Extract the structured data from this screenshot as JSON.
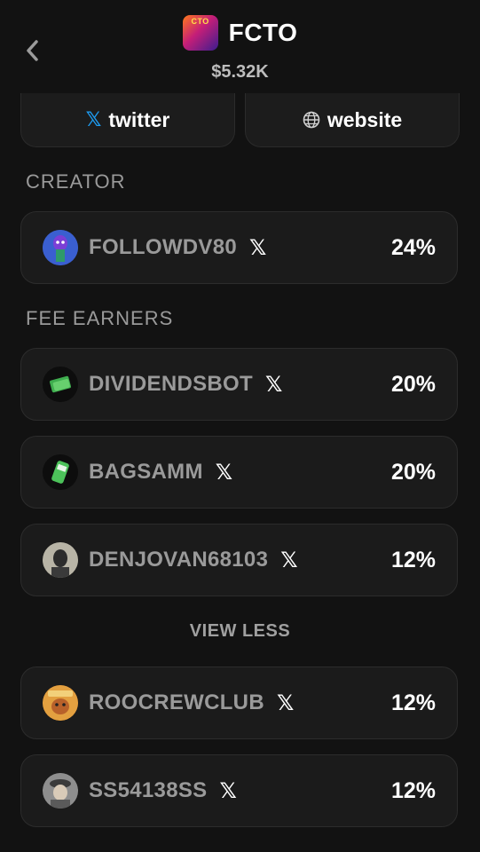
{
  "header": {
    "back_icon": "chevron-left-icon",
    "token_logo_text": "CTO",
    "token_name": "FCTO",
    "market_cap": "$5.32K"
  },
  "links": {
    "twitter": {
      "icon": "x-logo-icon",
      "label": "twitter"
    },
    "website": {
      "icon": "globe-icon",
      "label": "website"
    }
  },
  "creator": {
    "title": "CREATOR",
    "items": [
      {
        "name": "FOLLOWDV80",
        "percent": "24%",
        "avatar_color": "#3d6bd6"
      }
    ]
  },
  "fee_earners": {
    "title": "FEE EARNERS",
    "items": [
      {
        "name": "DIVIDENDSBOT",
        "percent": "20%",
        "avatar_color": "#2f9a4a"
      },
      {
        "name": "BAGSAMM",
        "percent": "20%",
        "avatar_color": "#3cb54a"
      },
      {
        "name": "DENJOVAN68103",
        "percent": "12%",
        "avatar_color": "#8a8a7a"
      }
    ],
    "view_less_label": "VIEW LESS",
    "more_items": [
      {
        "name": "ROOCREWCLUB",
        "percent": "12%",
        "avatar_color": "#d4832c"
      },
      {
        "name": "SS54138SS",
        "percent": "12%",
        "avatar_color": "#6a6a6a"
      }
    ]
  },
  "x_glyph": "𝕏"
}
